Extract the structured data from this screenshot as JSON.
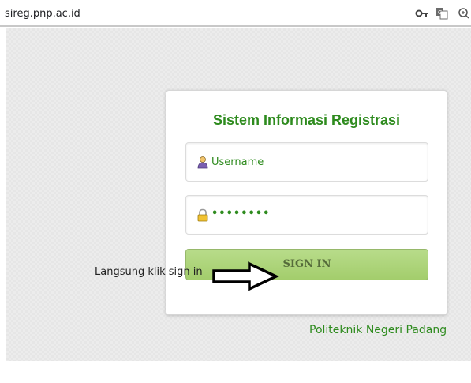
{
  "browser": {
    "url": "sireg.pnp.ac.id",
    "icons": [
      "key-icon",
      "translate-icon",
      "zoom-icon"
    ]
  },
  "login": {
    "title": "Sistem Informasi Registrasi",
    "username_placeholder": "Username",
    "password_value": "••••••••",
    "signin_label": "SIGN IN"
  },
  "annotation": {
    "note": "Langsung klik sign in",
    "arrow_icon": "right-arrow-icon"
  },
  "footer": {
    "institution": "Politeknik Negeri Padang"
  },
  "colors": {
    "accent_green": "#2e8b1e",
    "button_green": "#a3cd6c",
    "page_background": "#ececec"
  }
}
